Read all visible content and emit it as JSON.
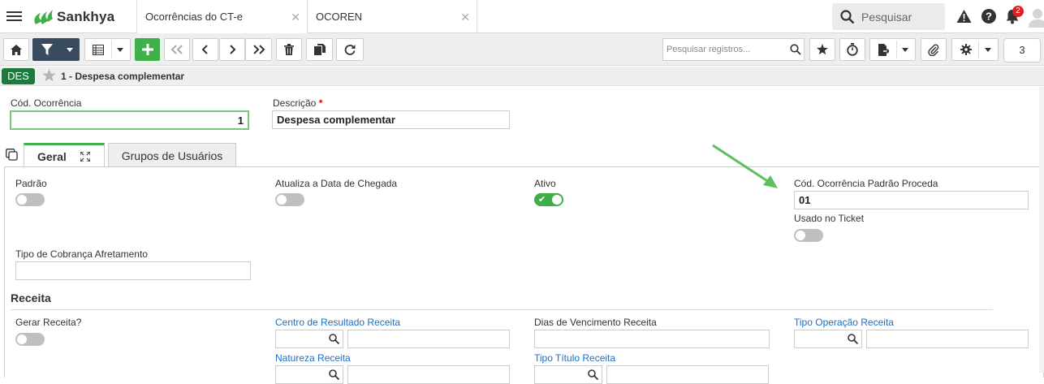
{
  "topbar": {
    "logo_text": "Sankhya",
    "tabs": [
      {
        "label": "Ocorrências do CT-e",
        "close": "✕"
      },
      {
        "label": "OCOREN",
        "close": "✕"
      }
    ],
    "search_placeholder": "Pesquisar",
    "notification_count": "2",
    "icons": [
      "menu-icon",
      "warning-icon",
      "help-icon",
      "bell-icon",
      "avatar-icon"
    ]
  },
  "toolbar": {
    "record_search_placeholder": "Pesquisar registros...",
    "record_count": "3",
    "icons": [
      "home-icon",
      "filter-icon",
      "grid-icon",
      "add-icon",
      "first-icon",
      "prev-icon",
      "next-icon",
      "last-icon",
      "delete-icon",
      "copy-icon",
      "refresh-icon",
      "star-icon",
      "timer-icon",
      "export-icon",
      "attach-icon",
      "settings-icon"
    ]
  },
  "record": {
    "badge": "DES",
    "title": "1 - Despesa complementar"
  },
  "form": {
    "cod_ocorrencia_label": "Cód. Ocorrência",
    "cod_ocorrencia_value": "1",
    "descricao_label": "Descrição",
    "descricao_required": "*",
    "descricao_value": "Despesa complementar"
  },
  "tabs": {
    "geral": "Geral",
    "grupos": "Grupos de Usuários"
  },
  "geral": {
    "padrao_label": "Padrão",
    "padrao_on": false,
    "atualiza_label": "Atualiza a Data de Chegada",
    "atualiza_on": false,
    "ativo_label": "Ativo",
    "ativo_on": true,
    "cod_proceda_label": "Cód. Ocorrência Padrão Proceda",
    "cod_proceda_value": "01",
    "usado_ticket_label": "Usado no Ticket",
    "usado_ticket_on": false,
    "tipo_cobranca_label": "Tipo de Cobrança Afretamento",
    "tipo_cobranca_value": ""
  },
  "receita": {
    "section_title": "Receita",
    "gerar_label": "Gerar Receita?",
    "gerar_on": false,
    "centro_label": "Centro de Resultado Receita",
    "dias_label": "Dias de Vencimento Receita",
    "tipo_operacao_label": "Tipo Operação Receita",
    "natureza_label": "Natureza Receita",
    "tipo_titulo_label": "Tipo Título Receita"
  },
  "colors": {
    "brand_green": "#40b14a",
    "dark_button": "#394c5d",
    "badge_green": "#1e7a3c",
    "link_blue": "#1a6fc9",
    "arrow_green": "#5cbf5c"
  }
}
